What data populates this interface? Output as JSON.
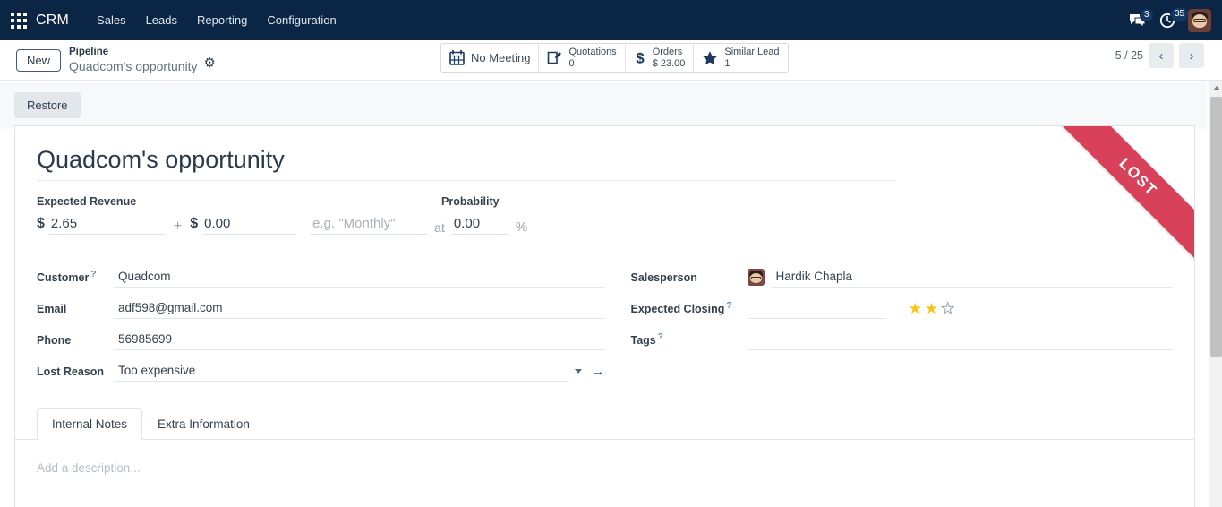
{
  "navbar": {
    "apps_icon": "apps-grid-icon",
    "brand": "CRM",
    "menu": [
      {
        "label": "Sales"
      },
      {
        "label": "Leads"
      },
      {
        "label": "Reporting"
      },
      {
        "label": "Configuration"
      }
    ],
    "messages_icon": "chat-bubbles-icon",
    "messages_count": "3",
    "activities_icon": "clock-icon",
    "activities_count": "35",
    "avatar_icon": "user-avatar"
  },
  "control_panel": {
    "new_button": "New",
    "breadcrumb_parent": "Pipeline",
    "breadcrumb_current": "Quadcom's opportunity",
    "settings_icon": "gear-icon",
    "stat_buttons": [
      {
        "icon": "calendar-icon",
        "label": "No Meeting",
        "value": ""
      },
      {
        "icon": "edit-document-icon",
        "label": "Quotations",
        "value": "0"
      },
      {
        "icon": "dollar-icon",
        "label": "Orders",
        "value": "$ 23.00"
      },
      {
        "icon": "star-icon",
        "label": "Similar Lead",
        "value": "1"
      }
    ],
    "pager_text": "5 / 25",
    "pager_prev_icon": "chevron-left-icon",
    "pager_next_icon": "chevron-right-icon"
  },
  "action_bar": {
    "restore_button": "Restore"
  },
  "form": {
    "ribbon": "LOST",
    "ribbon_color": "#d9415a",
    "title": "Quadcom's opportunity",
    "revenue": {
      "expected_revenue_label": "Expected Revenue",
      "probability_label": "Probability",
      "currency_symbol": "$",
      "expected_revenue_value": "2.65",
      "plus": "+",
      "recurring_currency_symbol": "$",
      "recurring_value": "0.00",
      "recurring_plan_placeholder": "e.g. \"Monthly\"",
      "recurring_plan_value": "",
      "at_word": "at",
      "probability_value": "0.00",
      "percent_symbol": "%"
    },
    "left_fields": [
      {
        "label": "Customer",
        "tip": "?",
        "value": "Quadcom"
      },
      {
        "label": "Email",
        "tip": "",
        "value": "adf598@gmail.com"
      },
      {
        "label": "Phone",
        "tip": "",
        "value": "56985699"
      },
      {
        "label": "Lost Reason",
        "tip": "",
        "value": "Too expensive"
      }
    ],
    "right_fields": {
      "salesperson_label": "Salesperson",
      "salesperson_value": "Hardik Chapla",
      "salesperson_avatar": "user-avatar",
      "expected_closing_label": "Expected Closing",
      "expected_closing_tip": "?",
      "expected_closing_value": "",
      "priority_stars_filled": 2,
      "priority_stars_total": 3,
      "tags_label": "Tags",
      "tags_tip": "?",
      "tags_value": ""
    },
    "dropdown_icon": "chevron-down-icon",
    "internal_link_icon": "arrow-right-icon",
    "tabs": [
      {
        "label": "Internal Notes",
        "active": true
      },
      {
        "label": "Extra Information",
        "active": false
      }
    ],
    "description_placeholder": "Add a description..."
  },
  "scrollbar": {
    "up_arrow_icon": "scroll-up-arrow-icon",
    "thumb": "scrollbar-thumb"
  }
}
